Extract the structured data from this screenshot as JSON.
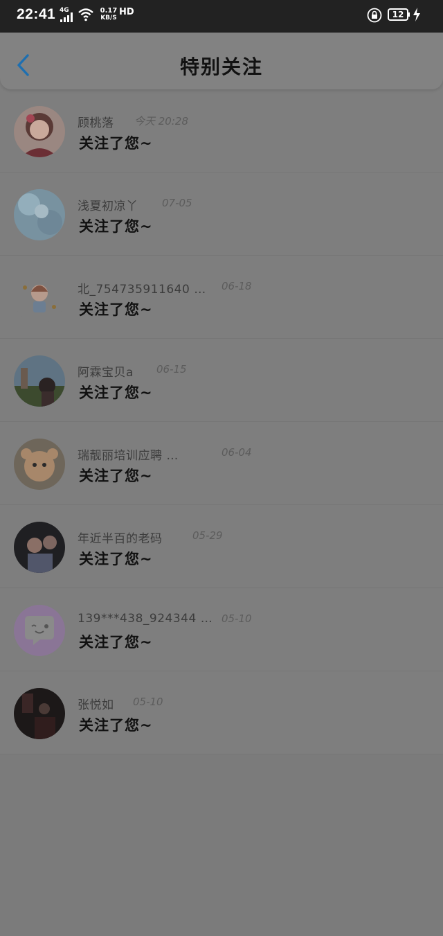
{
  "status_bar": {
    "time": "22:41",
    "network_type": "4G",
    "speed_value": "0.17",
    "speed_unit": "KB/S",
    "hd": "HD",
    "battery": "12"
  },
  "header": {
    "title": "特别关注",
    "back_icon": "chevron-left-icon",
    "accent_color": "#1e88d6"
  },
  "items": [
    {
      "name": "顾桃落",
      "date": "今天 20:28",
      "message": "关注了您~"
    },
    {
      "name": "浅夏初凉丫",
      "date": "07-05",
      "message": "关注了您~"
    },
    {
      "name": "北_754735911640 …",
      "date": "06-18",
      "message": "关注了您~"
    },
    {
      "name": "阿霖宝贝a",
      "date": "06-15",
      "message": "关注了您~"
    },
    {
      "name": "瑞靓丽培训应聘 …",
      "date": "06-04",
      "message": "关注了您~"
    },
    {
      "name": "年近半百的老码",
      "date": "05-29",
      "message": "关注了您~"
    },
    {
      "name": "139***438_924344 …",
      "date": "05-10",
      "message": "关注了您~"
    },
    {
      "name": "张悦如",
      "date": "05-10",
      "message": "关注了您~"
    }
  ]
}
